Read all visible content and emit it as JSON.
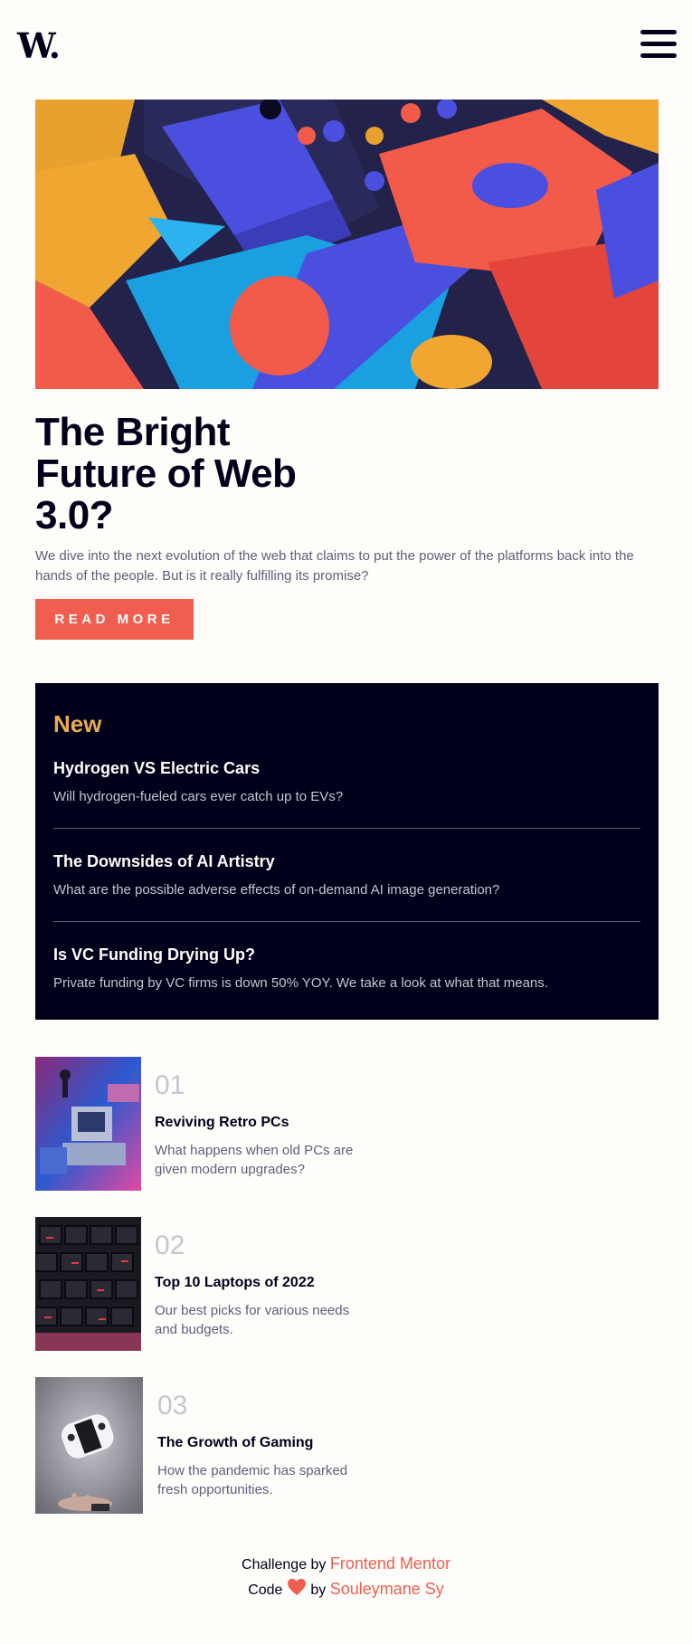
{
  "header": {
    "logo_text": "W.",
    "menu_icon": "hamburger-menu-icon"
  },
  "hero": {
    "title": "The Bright Future of Web 3.0?",
    "description": "We dive into the next evolution of the web that claims to put the power of the platforms back into the hands of the people. But is it really fulfilling its promise?",
    "button_label": "READ MORE"
  },
  "new_section": {
    "heading": "New",
    "items": [
      {
        "title": "Hydrogen VS Electric Cars",
        "text": "Will hydrogen-fueled cars ever catch up to EVs?"
      },
      {
        "title": "The Downsides of AI Artistry",
        "text": "What are the possible adverse effects of on-demand AI image generation?"
      },
      {
        "title": "Is VC Funding Drying Up?",
        "text": "Private funding by VC firms is down 50% YOY. We take a look at what that means."
      }
    ]
  },
  "ranked": [
    {
      "number": "01",
      "title": "Reviving Retro PCs",
      "text": "What happens when old PCs are given modern upgrades?"
    },
    {
      "number": "02",
      "title": "Top 10 Laptops of 2022",
      "text": "Our best picks for various needs and budgets."
    },
    {
      "number": "03",
      "title": "The Growth of Gaming",
      "text": "How the pandemic has sparked fresh opportunities."
    }
  ],
  "footer": {
    "challenge_prefix": "Challenge by",
    "challenge_link": "Frontend Mentor",
    "code_prefix": "Code",
    "code_by": "by",
    "author_link": "Souleymane Sy",
    "heart_icon": "heart-icon"
  },
  "colors": {
    "accent": "#f15e50",
    "new_heading": "#e9ab53",
    "dark": "#00001a",
    "muted": "#5d5f79",
    "number": "#c5c6ce"
  }
}
